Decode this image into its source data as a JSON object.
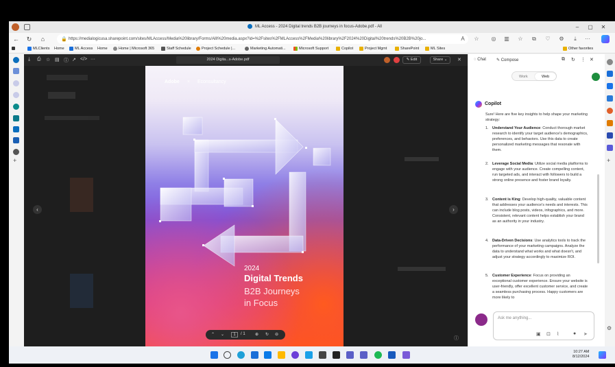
{
  "window": {
    "title": "ML Access - 2024 Digital trends B2B journeys in focus-Adobe.pdf - All",
    "url": "https://medialogicusa.sharepoint.com/sites/MLAccess/Media%20library/Forms/AllI%20media.aspx?id=%2Fsites%2FMLAccess%2FMedia%20library%2F2024%20Digital%20trends%20B2B%20jo..."
  },
  "favorites": [
    {
      "label": "MLClients",
      "color": "#1a73e8"
    },
    {
      "label": "Home",
      "color": "#1a73e8"
    },
    {
      "label": "ML Access",
      "color": "#1a6ed8"
    },
    {
      "label": "Home",
      "color": "#1a6ed8"
    },
    {
      "label": "Home | Microsoft 365",
      "color": "#d04a02"
    },
    {
      "label": "Staff Schedule",
      "color": "#555555"
    },
    {
      "label": "Project Schedule |...",
      "color": "#e07b00"
    },
    {
      "label": "Marketing Automati...",
      "color": "#5a5a5a"
    },
    {
      "label": "Microsoft Support",
      "color": "#f25022"
    },
    {
      "label": "Copilot",
      "color": "#e8b000"
    },
    {
      "label": "Project Mgmt",
      "color": "#e8b000"
    },
    {
      "label": "SharePoint",
      "color": "#e8b000"
    },
    {
      "label": "ML Sites",
      "color": "#e8b000"
    }
  ],
  "other_favorites": "Other favorites",
  "pdf": {
    "filename": "2024 Digita...s-Adobe.pdf",
    "edit_label": "Edit",
    "share_label": "Share",
    "page_current": "1",
    "page_total": "/ 1",
    "brand_left": "Adobe",
    "brand_x": "×",
    "brand_right": "Econsultancy",
    "cover_year": "2024",
    "cover_title": "Digital Trends",
    "cover_sub1": "B2B Journeys",
    "cover_sub2": "in Focus"
  },
  "copilot": {
    "tab_chat": "Chat",
    "tab_compose": "Compose",
    "toggle_work": "Work",
    "toggle_web": "Web",
    "name": "Copilot",
    "intro": "Sure! Here are five key insights to help shape your marketing strategy:",
    "insights": [
      {
        "num": "1.",
        "title": "Understand Your Audience",
        "body": ": Conduct thorough market research to identify your target audience's demographics, preferences, and behaviors. Use this data to create personalized marketing messages that resonate with them."
      },
      {
        "num": "2.",
        "title": "Leverage Social Media",
        "body": ": Utilize social media platforms to engage with your audience. Create compelling content, run targeted ads, and interact with followers to build a strong online presence and foster brand loyalty."
      },
      {
        "num": "3.",
        "title": "Content is King",
        "body": ": Develop high-quality, valuable content that addresses your audience's needs and interests. This can include blog posts, videos, infographics, and more. Consistent, relevant content helps establish your brand as an authority in your industry."
      },
      {
        "num": "4.",
        "title": "Data-Driven Decisions",
        "body": ": Use analytics tools to track the performance of your marketing campaigns. Analyze the data to understand what works and what doesn't, and adjust your strategy accordingly to maximize ROI."
      },
      {
        "num": "5.",
        "title": "Customer Experience",
        "body": ": Focus on providing an exceptional customer experience. Ensure your website is user-friendly, offer excellent customer service, and create a seamless purchasing process. Happy customers are more likely to"
      }
    ],
    "ask_placeholder": "Ask me anything..."
  },
  "taskbar": {
    "time": "10:27 AM",
    "date": "8/12/2024"
  }
}
